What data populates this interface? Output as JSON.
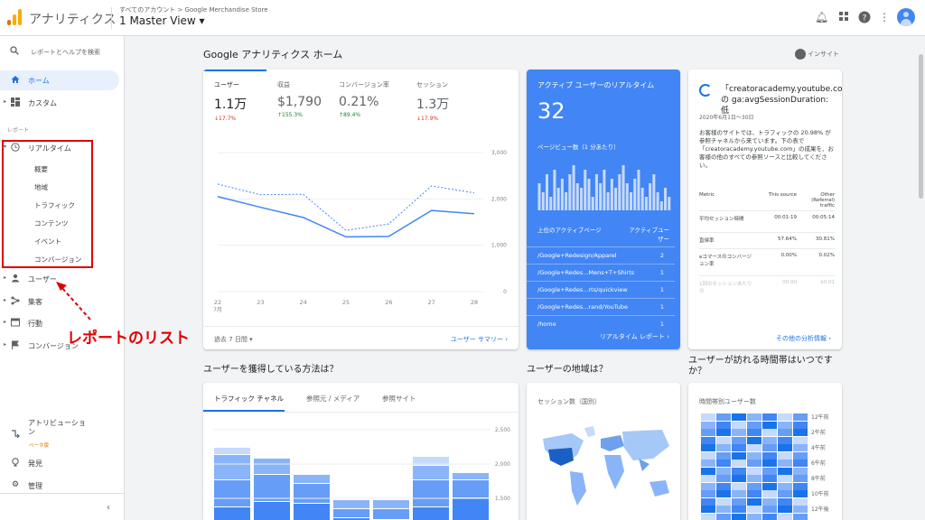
{
  "header": {
    "app_title": "アナリティクス",
    "breadcrumb": "すべてのアカウント > Google Merchandise Store",
    "view": "1 Master View ▾",
    "logo_colors": [
      "#f9ab00",
      "#e37400",
      "#e37400"
    ]
  },
  "sidebar": {
    "search_placeholder": "レポートとヘルプを検索",
    "items": [
      {
        "label": "ホーム",
        "icon": "home-icon"
      },
      {
        "label": "カスタム",
        "icon": "dashboard-icon"
      },
      {
        "label": "リアルタイム",
        "icon": "clock-icon"
      },
      {
        "label": "ユーザー",
        "icon": "person-icon"
      },
      {
        "label": "集客",
        "icon": "acquisition-icon"
      },
      {
        "label": "行動",
        "icon": "behavior-icon"
      },
      {
        "label": "コンバージョン",
        "icon": "flag-icon"
      }
    ],
    "reports_label": "レポート",
    "realtime_sub": [
      "概要",
      "地域",
      "トラフィック",
      "コンテンツ",
      "イベント",
      "コンバージョン"
    ],
    "bottom": [
      {
        "label": "アトリビューション",
        "icon": "attribution-icon"
      },
      {
        "label": "発見",
        "icon": "lightbulb-icon"
      },
      {
        "label": "管理",
        "icon": "gear-icon"
      }
    ],
    "attribution_lines": [
      "アトリビューショ",
      "ン"
    ],
    "beta": "ベータ版",
    "collapse": "‹"
  },
  "annotation": {
    "text": "レポートのリスト",
    "color": "#e00000"
  },
  "main": {
    "title": "Google アナリティクス ホーム",
    "insight": "インサイト"
  },
  "overview": {
    "metrics": [
      {
        "label": "ユーザー",
        "value": "1.1万",
        "change": "↓17.7%",
        "dir": "down"
      },
      {
        "label": "収益",
        "value": "$1,790",
        "change": "↑155.3%",
        "dir": "up"
      },
      {
        "label": "コンバージョン率",
        "value": "0.21%",
        "change": "↑89.4%",
        "dir": "up"
      },
      {
        "label": "セッション",
        "value": "1.3万",
        "change": "↓17.9%",
        "dir": "down"
      }
    ],
    "x_labels": [
      "22",
      "23",
      "24",
      "25",
      "26",
      "27",
      "28"
    ],
    "x_sub": "7月",
    "y_labels": [
      "3,000",
      "2,000",
      "1,000",
      "0"
    ],
    "date_range": "過去 7 日間 ▾",
    "link": "ユーザー サマリー"
  },
  "chart_data": {
    "type": "line",
    "x": [
      "22",
      "23",
      "24",
      "25",
      "26",
      "27",
      "28"
    ],
    "ylim": [
      0,
      3000
    ],
    "series": [
      {
        "values": [
          2050,
          1820,
          1600,
          1180,
          1190,
          1750,
          1680
        ],
        "style": "solid"
      },
      {
        "values": [
          2320,
          2090,
          2100,
          1320,
          1460,
          2280,
          2130
        ],
        "style": "dotted"
      }
    ]
  },
  "realtime": {
    "title": "アクティブ ユーザーのリアルタイム",
    "count": "32",
    "pageviews_label": "ページビュー数（1 分あたり）",
    "bars": [
      6,
      4,
      8,
      3,
      9,
      5,
      7,
      4,
      8,
      10,
      6,
      5,
      9,
      7,
      3,
      8,
      6,
      9,
      4,
      7,
      5,
      8,
      10,
      6,
      4,
      7,
      9,
      5,
      3,
      6,
      8,
      4,
      2,
      5,
      3
    ],
    "col_page": "上位のアクティブページ",
    "col_users": "アクティブユーザー",
    "rows": [
      {
        "page": "/Google+Redesign/Apparel",
        "count": "2"
      },
      {
        "page": "/Google+Redes...Mens+T+Shirts",
        "count": "1"
      },
      {
        "page": "/Google+Redes...rts/quickview",
        "count": "1"
      },
      {
        "page": "/Google+Redes...rand/YouTube",
        "count": "1"
      },
      {
        "page": "/home",
        "count": "1"
      }
    ],
    "link": "リアルタイム レポート"
  },
  "insight_card": {
    "title": "「creatoracademy.youtube.com」の ga:avgSessionDuration: 低",
    "date": "2020年6月1日～30日",
    "body": "お客様のサイトでは、トラフィックの 20.98% が参照チャネルから来ています。下の表で「creatoracademy.youtube.com」の成果を、お客様の他のすべての参照ソースと比較してください。",
    "head": {
      "metric": "Metric",
      "source": "This source",
      "other": "Other (Referral) traffic"
    },
    "rows": [
      {
        "metric": "平均セッション時間",
        "source": "00:01:19",
        "other": "00:05:14"
      },
      {
        "metric": "直帰率",
        "source": "57.64%",
        "other": "30.81%"
      },
      {
        "metric": "eコマースのコンバージョン率",
        "source": "0.00%",
        "other": "0.02%"
      },
      {
        "metric": "1回のセッションあたりの",
        "source": "00.00",
        "other": "$0.01"
      }
    ],
    "link": "その他の分析情報"
  },
  "acquisition": {
    "title": "ユーザーを獲得している方法は？",
    "tabs": [
      "トラフィック チャネル",
      "参照元 / メディア",
      "参照サイト"
    ],
    "y_labels": [
      "2,500",
      "2,000",
      "1,500"
    ],
    "stacks": [
      [
        8,
        28,
        30,
        22
      ],
      [
        18,
        30,
        28
      ],
      [
        10,
        22,
        26
      ],
      [
        10,
        10,
        10
      ],
      [
        10,
        12,
        8
      ],
      [
        10,
        16,
        30,
        22
      ],
      [
        8,
        20,
        32
      ]
    ]
  },
  "geo": {
    "title": "ユーザーの地域は？",
    "label": "セッション数（国別）"
  },
  "timeofday": {
    "title": "ユーザーが訪れる時間帯はいつですか？",
    "label": "時間帯別ユーザー数",
    "rows": [
      "12午前",
      "2午前",
      "4午前",
      "6午前",
      "8午前",
      "10午前",
      "12午後"
    ]
  },
  "colors": {
    "accent": "#1a73e8",
    "realtime_bg": "#4285f4",
    "down": "#d93025",
    "up": "#188038"
  }
}
